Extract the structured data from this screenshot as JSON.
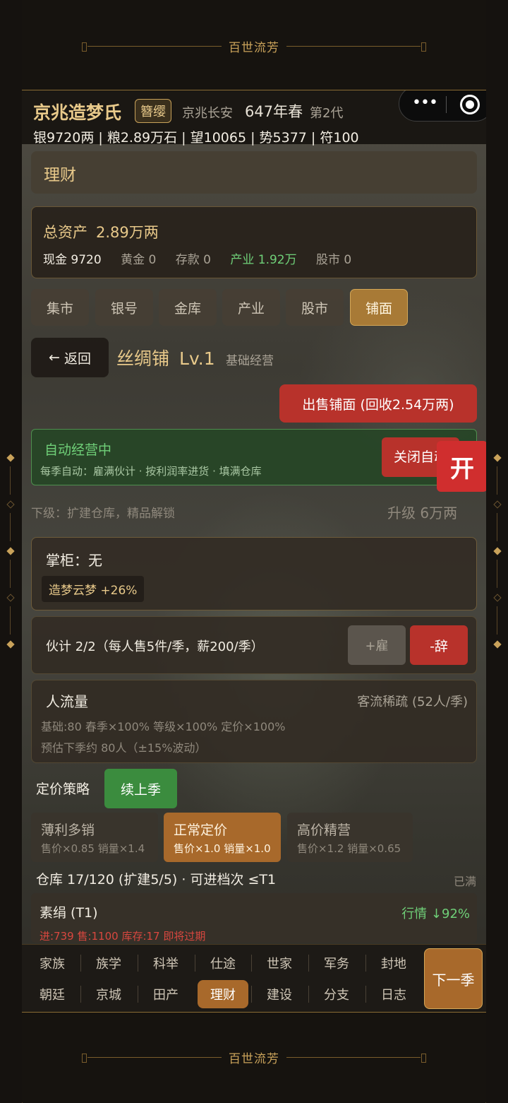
{
  "frame": {
    "banner_text": "百世流芳"
  },
  "header": {
    "family_name": "京兆造梦氏",
    "rank": "簪缨",
    "location": "京兆长安",
    "year": "647年春",
    "generation": "第2代",
    "stats": "银9720两 | 粮2.89万石 | 望10065 | 势5377 | 符100"
  },
  "section": {
    "title": "理财"
  },
  "assets": {
    "total_label": "总资产",
    "total_value": "2.89万两",
    "cash": "现金 9720",
    "gold": "黄金 0",
    "deposit": "存款 0",
    "industry": "产业 1.92万",
    "stock": "股市 0"
  },
  "tabs": [
    {
      "label": "集市"
    },
    {
      "label": "银号"
    },
    {
      "label": "金库"
    },
    {
      "label": "产业"
    },
    {
      "label": "股市"
    },
    {
      "label": "铺面",
      "active": true
    }
  ],
  "shop": {
    "back_label": "返回",
    "name": "丝绸铺",
    "level": "Lv.1",
    "mode": "基础经营",
    "sell_label": "出售铺面 (回收2.54万两)",
    "auto_title": "自动经营中",
    "auto_desc": "每季自动：雇满伙计 · 按利润率进货 · 填满仓库",
    "close_auto_label": "关闭自动",
    "open_label": "开",
    "next_level": "下级：扩建仓库，精品解锁",
    "upgrade": "升级 6万两"
  },
  "manager": {
    "title": "掌柜：无",
    "tag": "造梦云梦 +26%"
  },
  "staff": {
    "text": "伙计 2/2（每人售5件/季，薪200/季）",
    "hire_label": "+雇",
    "fire_label": "-辞"
  },
  "traffic": {
    "title": "人流量",
    "status": "客流稀疏 (52人/季)",
    "factors": "基础:80  春季×100%  等级×100%  定价×100%",
    "forecast": "预估下季约 80人（±15%波动）"
  },
  "pricing": {
    "label": "定价策略",
    "continue_label": "续上季",
    "strategies": [
      {
        "name": "薄利多销",
        "detail": "售价×0.85 销量×1.4"
      },
      {
        "name": "正常定价",
        "detail": "售价×1.0 销量×1.0",
        "active": true
      },
      {
        "name": "高价精营",
        "detail": "售价×1.2 销量×0.65"
      }
    ]
  },
  "warehouse": {
    "text": "仓库 17/120 (扩建5/5)  ·  可进档次 ≤T1",
    "status": "已满",
    "goods": [
      {
        "name": "素绢 (T1)",
        "market": "行情 ↓92%",
        "stats": "进:739  售:1100  库存:17  即将过期"
      }
    ]
  },
  "bottom_nav": {
    "row1": [
      "家族",
      "族学",
      "科举",
      "仕途",
      "世家",
      "军务",
      "封地"
    ],
    "row2": [
      "朝廷",
      "京城",
      "田产",
      "理财",
      "建设",
      "分支",
      "日志"
    ],
    "active": "理财",
    "next_label": "下一季"
  },
  "colors": {
    "gold_accent": "#e8c98a",
    "active_tab": "#a87a36",
    "danger": "#b8322b",
    "success": "#3b8c3e",
    "positive_text": "#6fcf78"
  }
}
